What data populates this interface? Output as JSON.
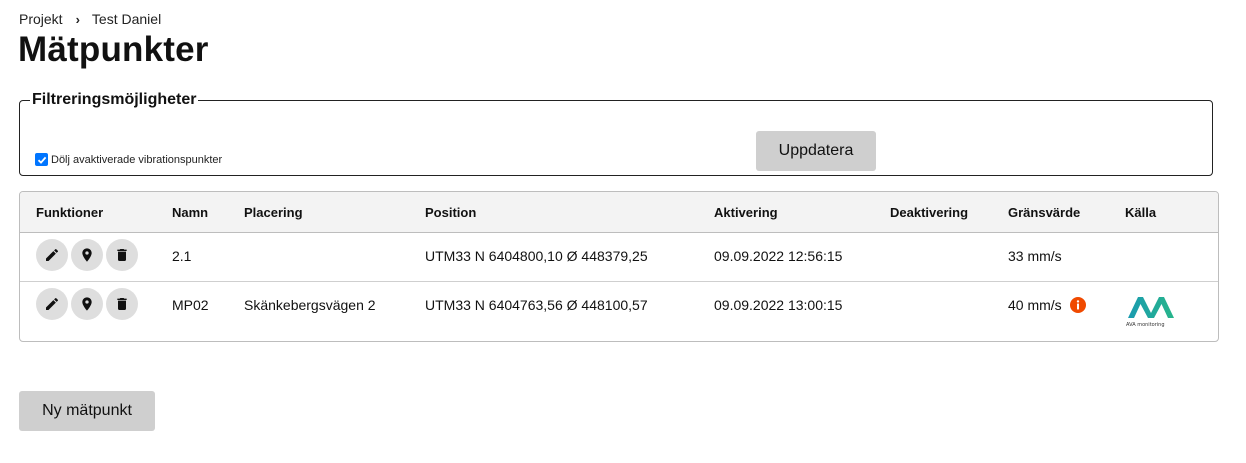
{
  "breadcrumb": {
    "parent": "Projekt",
    "current": "Test Daniel"
  },
  "page_title": "Mätpunkter",
  "filters": {
    "legend": "Filtreringsmöjligheter",
    "checkbox_label": "Dölj avaktiverade vibrationspunkter",
    "checkbox_checked": true,
    "update_button": "Uppdatera"
  },
  "table": {
    "columns": [
      "Funktioner",
      "Namn",
      "Placering",
      "Position",
      "Aktivering",
      "Deaktivering",
      "Gränsvärde",
      "Källa"
    ],
    "rows": [
      {
        "namn": "2.1",
        "placering": "",
        "position": "UTM33 N 6404800,10 Ø 448379,25",
        "aktivering": "09.09.2022 12:56:15",
        "deaktivering": "",
        "gransvarde": "33 mm/s",
        "info": false,
        "kalla": ""
      },
      {
        "namn": "MP02",
        "placering": "Skänkebergsvägen 2",
        "position": "UTM33 N 6404763,56 Ø 448100,57",
        "aktivering": "09.09.2022 13:00:15",
        "deaktivering": "",
        "gransvarde": "40 mm/s",
        "info": true,
        "kalla": "AVA monitoring logo",
        "logo_text": "AVA monitoring"
      }
    ]
  },
  "icons": {
    "edit": "pencil-icon",
    "location": "map-pin-icon",
    "delete": "trash-icon",
    "info": "info-icon"
  },
  "colors": {
    "checkbox": "#0075ff",
    "info": "#f04a00",
    "logo_teal": "#1aa39a",
    "button_bg": "#cfcfcf"
  },
  "new_button": "Ny mätpunkt"
}
